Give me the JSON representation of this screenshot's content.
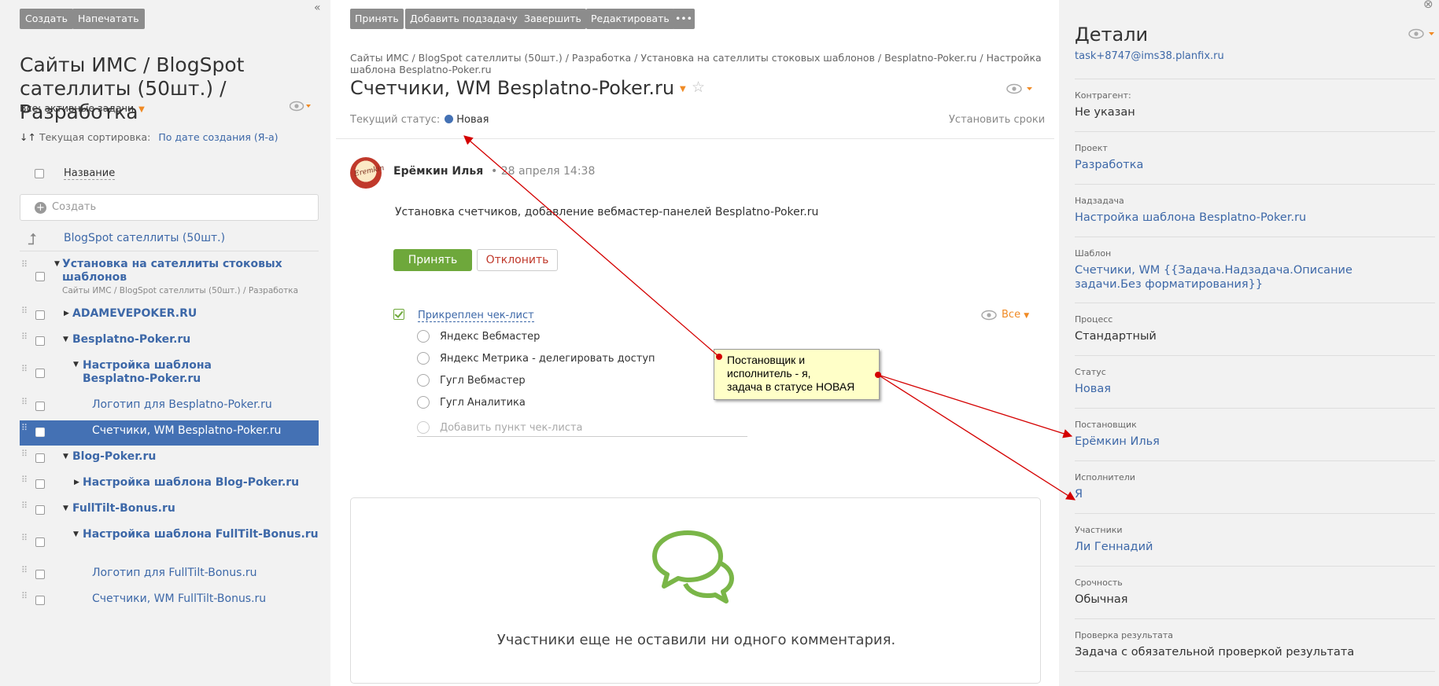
{
  "left": {
    "toolbar": {
      "create": "Создать",
      "print": "Напечатать"
    },
    "collapse": "«",
    "title": "Сайты ИМС / BlogSpot сателлиты (50шт.) / Разработка",
    "filter": "Все: активные задачи",
    "sort_label": "Текущая сортировка:",
    "sort_value": "По дате создания (Я-а)",
    "name_header": "Название",
    "create_placeholder": "Создать",
    "parent": "BlogSpot сателлиты (50шт.)",
    "tree": [
      {
        "label": "Установка на сателлиты стоковых шаблонов",
        "sub": "Сайты ИМС / BlogSpot сателлиты (50шт.) / Разработка"
      },
      {
        "label": "ADAMEVEPOKER.RU"
      },
      {
        "label": "Besplatno-Poker.ru"
      },
      {
        "label": "Настройка шаблона Besplatno-Poker.ru"
      },
      {
        "label": "Логотип для Besplatno-Poker.ru"
      },
      {
        "label": "Счетчики, WM Besplatno-Poker.ru"
      },
      {
        "label": "Blog-Poker.ru"
      },
      {
        "label": "Настройка шаблона Blog-Poker.ru"
      },
      {
        "label": "FullTilt-Bonus.ru"
      },
      {
        "label": "Настройка шаблона FullTilt-Bonus.ru"
      },
      {
        "label": "Логотип для FullTilt-Bonus.ru"
      },
      {
        "label": "Счетчики, WM FullTilt-Bonus.ru"
      }
    ]
  },
  "middle": {
    "toolbar": {
      "accept": "Принять",
      "add_subtask": "Добавить подзадачу",
      "finish": "Завершить",
      "edit": "Редактировать",
      "more": "•••"
    },
    "breadcrumb": "Сайты ИМС / BlogSpot сателлиты (50шт.) / Разработка / Установка на сателлиты стоковых шаблонов / Besplatno-Poker.ru / Настройка шаблона Besplatno-Poker.ru",
    "title": "Счетчики, WM Besplatno-Poker.ru",
    "status_label": "Текущий статус:",
    "status_value": "Новая",
    "set_deadline": "Установить сроки",
    "avatar_text": "Eremkin",
    "author": "Ерёмкин Илья",
    "date": "• 28 апреля 14:38",
    "description": "Установка счетчиков, добавление вебмастер-панелей  Besplatno-Poker.ru",
    "accept": "Принять",
    "decline": "Отклонить",
    "checklist_title": "Прикреплен чек-лист",
    "checklist_filter": "Все",
    "checklist": [
      "Яндекс Вебмастер",
      "Яндекс Метрика - делегировать доступ",
      "Гугл Вебмастер",
      "Гугл Аналитика"
    ],
    "checklist_add": "Добавить пункт чек-листа",
    "no_comments": "Участники еще не оставили ни одного комментария."
  },
  "right": {
    "title": "Детали",
    "scroll_hint": "task+8747@ims38.planfix.ru",
    "fields": [
      {
        "label": "Контрагент:",
        "value": "Не указан",
        "link": false
      },
      {
        "label": "Проект",
        "value": "Разработка",
        "link": true
      },
      {
        "label": "Надзадача",
        "value": "Настройка шаблона Besplatno-Poker.ru",
        "link": true
      },
      {
        "label": "Шаблон",
        "value": "Счетчики, WM {{Задача.Надзадача.Описание задачи.Без форматирования}}",
        "link": true
      },
      {
        "label": "Процесс",
        "value": "Стандартный",
        "link": false
      },
      {
        "label": "Статус",
        "value": "Новая",
        "link": true
      },
      {
        "label": "Постановщик",
        "value": "Ерёмкин Илья",
        "link": true
      },
      {
        "label": "Исполнители",
        "value": "Я",
        "link": true
      },
      {
        "label": "Участники",
        "value": "Ли Геннадий",
        "link": true
      },
      {
        "label": "Срочность",
        "value": "Обычная",
        "link": false
      },
      {
        "label": "Проверка результата",
        "value": "Задача с обязательной проверкой результата",
        "link": false
      }
    ]
  },
  "annotation": {
    "text_line1": "Постановщик и",
    "text_line2": "исполнитель - я,",
    "text_line3": "задача в статусе НОВАЯ"
  },
  "colors": {
    "accent_blue": "#3d68a8",
    "selection": "#4471b4",
    "accept_green": "#6ea83b",
    "orange": "#f08a24",
    "arrow_red": "#d40000"
  }
}
